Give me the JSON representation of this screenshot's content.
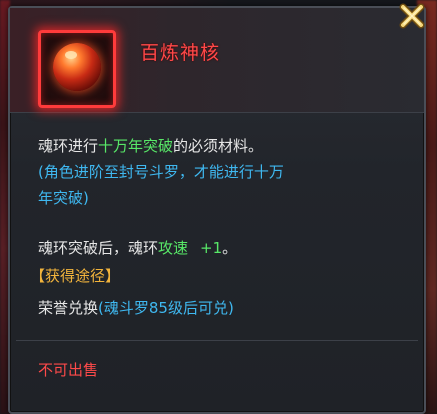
{
  "item": {
    "name": "百炼神核",
    "icon": "red-orb-icon"
  },
  "description": {
    "line1_prefix": "魂环进行",
    "line1_highlight": "十万年突破",
    "line1_suffix": "的必须材料。",
    "line2": "(角色进阶至封号斗罗，才能进行十万",
    "line3": "年突破)",
    "line4_prefix": "魂环突破后，魂环",
    "line4_highlight": "攻速",
    "line4_value": "+1",
    "line4_suffix": "。",
    "source_title": "【获得途径】",
    "source_prefix": "荣誉兑换",
    "source_note": "(魂斗罗85级后可兑)"
  },
  "footer": {
    "sell_status": "不可出售"
  },
  "colors": {
    "name": "#ff4848",
    "highlight_green": "#58e868",
    "note_blue": "#3fb8f0",
    "source_gold": "#f2b43c",
    "footer_red": "#ff4a4a"
  },
  "close_icon": "close-x-icon"
}
